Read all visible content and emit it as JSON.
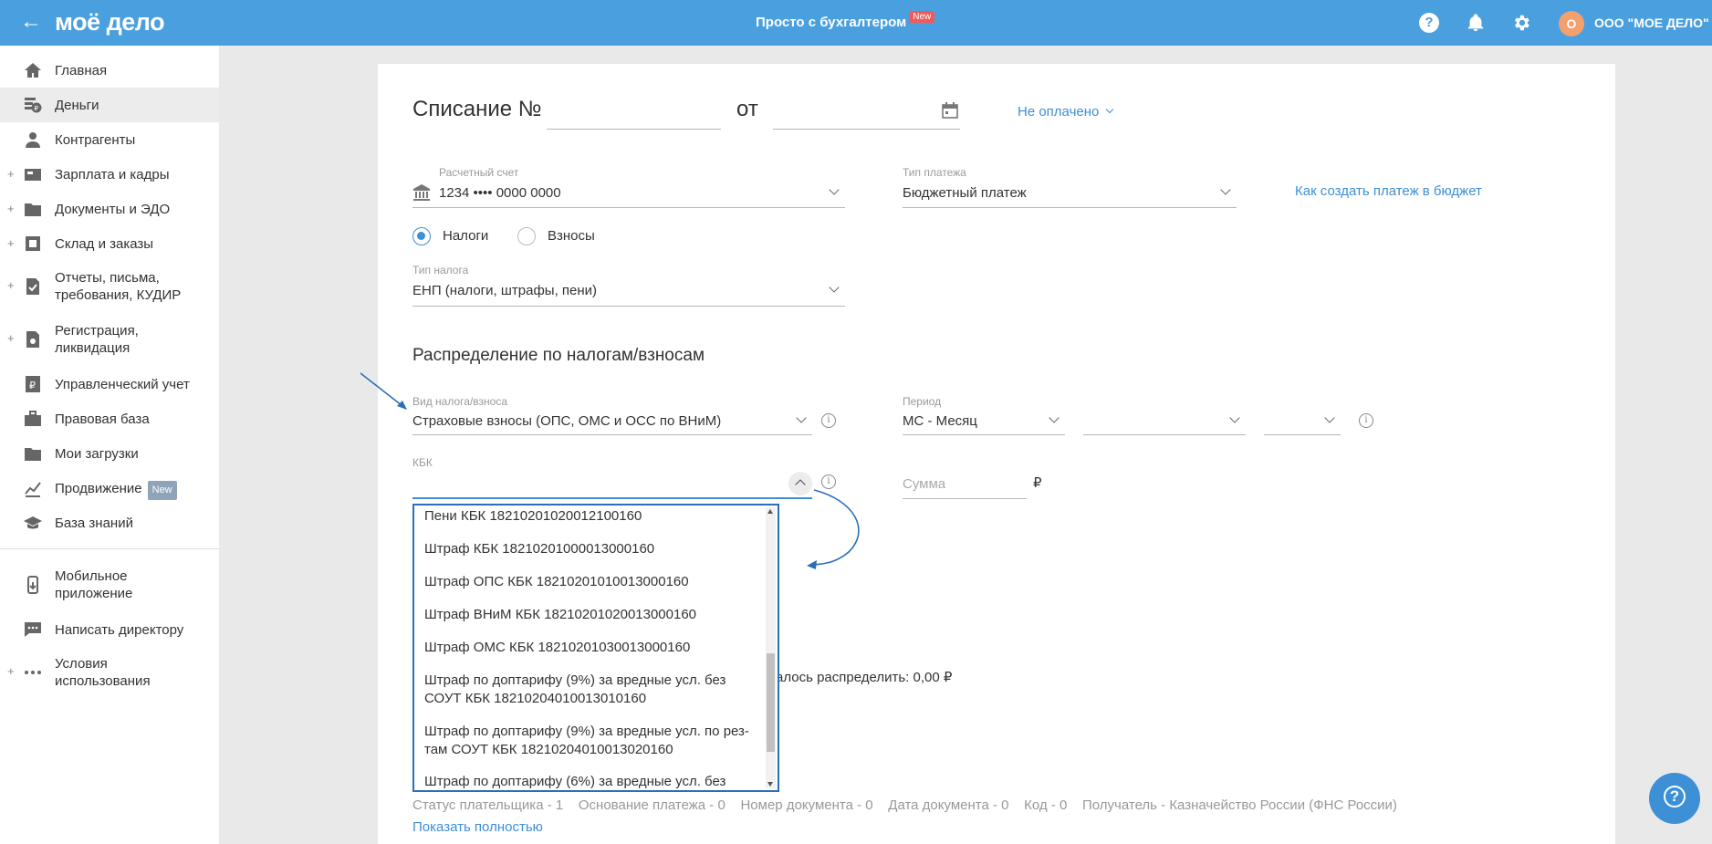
{
  "header": {
    "back_icon": "arrow-left-icon",
    "logo": "моё дело",
    "center_title": "Просто с бухгалтером",
    "center_badge": "New",
    "help_icon": "question-icon",
    "bell_icon": "bell-icon",
    "gear_icon": "gear-icon",
    "avatar_letter": "О",
    "org_name": "ООО \"МОЕ ДЕЛО\""
  },
  "sidebar": {
    "items": [
      {
        "label": "Главная",
        "icon": "home-icon"
      },
      {
        "label": "Деньги",
        "icon": "money-icon",
        "active": true
      },
      {
        "label": "Контрагенты",
        "icon": "contractors-icon"
      },
      {
        "label": "Зарплата и кадры",
        "icon": "salary-icon",
        "expandable": true
      },
      {
        "label": "Документы и ЭДО",
        "icon": "folder-icon",
        "expandable": true
      },
      {
        "label": "Склад и заказы",
        "icon": "warehouse-icon",
        "expandable": true
      },
      {
        "label": "Отчеты, письма, требования, КУДИР",
        "icon": "reports-icon",
        "expandable": true
      },
      {
        "label": "Регистрация, ликвидация",
        "icon": "registration-icon",
        "expandable": true
      },
      {
        "label": "Управленческий учет",
        "icon": "management-icon"
      },
      {
        "label": "Правовая база",
        "icon": "briefcase-icon"
      },
      {
        "label": "Мои загрузки",
        "icon": "folder-icon"
      },
      {
        "label": "Продвижение",
        "icon": "promotion-icon",
        "badge": "New"
      },
      {
        "label": "База знаний",
        "icon": "graduation-cap-icon"
      },
      {
        "label": "Мобильное приложение",
        "icon": "mobile-icon"
      },
      {
        "label": "Написать директору",
        "icon": "chat-icon"
      },
      {
        "label": "Условия использования",
        "icon": "more-icon",
        "expandable": true
      }
    ]
  },
  "form": {
    "title": "Списание №",
    "from_label": "от",
    "number_value": "",
    "date_value": "",
    "calendar_icon": "calendar-icon",
    "status_link": "Не оплачено",
    "account_label": "Расчетный счет",
    "account_value": "1234 •••• 0000 0000",
    "account_icon": "bank-icon",
    "payment_type_label": "Тип платежа",
    "payment_type_value": "Бюджетный платеж",
    "budget_help_link": "Как создать платеж в бюджет",
    "radio_taxes": "Налоги",
    "radio_contributions": "Взносы",
    "radio_selected": "Налоги",
    "tax_type_label": "Тип налога",
    "tax_type_value": "ЕНП (налоги, штрафы, пени)",
    "distribution_title": "Распределение по налогам/взносам",
    "kind_label": "Вид налога/взноса",
    "kind_value": "Страховые взносы (ОПС, ОМС и ОСС по ВНиМ)",
    "period_label": "Период",
    "period_value": "МС - Месяц",
    "period_month_value": "",
    "period_year_value": "",
    "kbk_label": "КБК",
    "kbk_value": "",
    "sum_placeholder": "Сумма",
    "currency": "₽",
    "remaining_text": "алось распределить: 0,00 ₽"
  },
  "kbk_dropdown": {
    "items": [
      "Пени КБК 18210201020012100160",
      "Штраф КБК 18210201000013000160",
      "Штраф ОПС КБК 18210201010013000160",
      "Штраф ВНиМ КБК 18210201020013000160",
      "Штраф ОМС КБК 18210201030013000160",
      "Штраф по доптарифу (9%) за вредные усл. без СОУТ КБК 18210204010013010160",
      "Штраф по доптарифу (9%) за вредные усл. по рез-там СОУТ КБК 18210204010013020160",
      "Штраф по доптарифу (6%) за вредные усл. без"
    ]
  },
  "footer": {
    "details": "Статус плательщика - 1    Основание платежа - 0    Номер документа - 0    Дата документа - 0    Код - 0    Получатель - Казначейство России (ФНС России)",
    "show_full": "Показать полностью"
  },
  "fab_icon": "question-icon"
}
